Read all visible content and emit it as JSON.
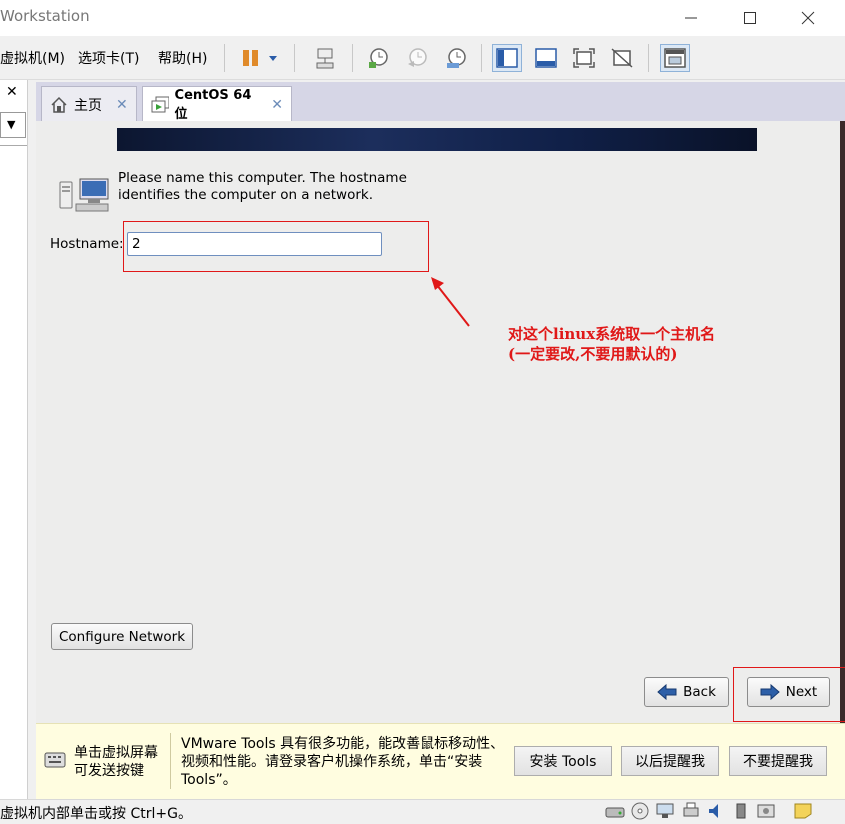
{
  "window": {
    "title": "Workstation"
  },
  "menu": [
    "虚拟机(M)",
    "选项卡(T)",
    "帮助(H)"
  ],
  "tabs": [
    {
      "label": "主页"
    },
    {
      "label": "CentOS 64 位"
    }
  ],
  "installer": {
    "prompt": "Please name this computer.  The hostname identifies the computer on a network.",
    "hostname_label": "Hostname:",
    "hostname_value": "2",
    "configure_network": "Configure Network",
    "back": "Back",
    "next": "Next"
  },
  "annotation": {
    "line1": "对这个linux系统取一个主机名",
    "line2": "(一定要改,不要用默认的)"
  },
  "tools_bar": {
    "click_hint_line1": "单击虚拟屏幕",
    "click_hint_line2": "可发送按键",
    "message": "VMware Tools 具有很多功能，能改善鼠标移动性、视频和性能。请登录客户机操作系统，单击“安装 Tools”。",
    "install": "安装 Tools",
    "remind_later": "以后提醒我",
    "never_remind": "不要提醒我"
  },
  "status_bar": {
    "text": "虚拟机内部单击或按 Ctrl+G。"
  },
  "colors": {
    "annotation_red": "#e01818",
    "banner_navy": "#1c2e5c",
    "tools_bar_bg": "#fffde0"
  }
}
